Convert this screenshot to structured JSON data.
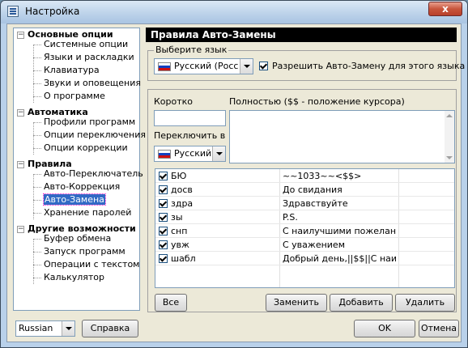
{
  "window": {
    "title": "Настройка",
    "close_label": "x"
  },
  "tree": [
    {
      "label": "Основные опции",
      "cat": true
    },
    {
      "label": "Системные опции"
    },
    {
      "label": "Языки и раскладки"
    },
    {
      "label": "Клавиатура"
    },
    {
      "label": "Звуки и оповещения"
    },
    {
      "label": "О программе"
    },
    {
      "label": "Автоматика",
      "cat": true
    },
    {
      "label": "Профили программ"
    },
    {
      "label": "Опции переключения"
    },
    {
      "label": "Опции коррекции"
    },
    {
      "label": "Правила",
      "cat": true
    },
    {
      "label": "Авто-Переключатель"
    },
    {
      "label": "Авто-Коррекция"
    },
    {
      "label": "Авто-Замена",
      "selected": true
    },
    {
      "label": "Хранение паролей"
    },
    {
      "label": "Другие возможности",
      "cat": true
    },
    {
      "label": "Буфер обмена"
    },
    {
      "label": "Запуск программ"
    },
    {
      "label": "Операции с текстом"
    },
    {
      "label": "Калькулятор"
    }
  ],
  "panel": {
    "header": "Правила Авто-Замены",
    "choose_language_label": "Выберите язык",
    "language_value": "Русский (Россия)",
    "allow_checkbox_label": "Разрешить Авто-Замену для этого языка",
    "allow_checked": true,
    "short_label": "Коротко",
    "short_value": "",
    "full_label": "Полностью ($$ - положение курсора)",
    "full_value": "",
    "switch_label": "Переключить в",
    "switch_value": "Русский"
  },
  "rules": [
    {
      "short": "БЮ",
      "full": "~~1033~~<$$>",
      "checked": true
    },
    {
      "short": "досв",
      "full": "До свидания",
      "checked": true
    },
    {
      "short": "здра",
      "full": "Здравствуйте",
      "checked": true
    },
    {
      "short": "зы",
      "full": "P.S.",
      "checked": true
    },
    {
      "short": "снп",
      "full": "С наилучшими пожелани...",
      "checked": true
    },
    {
      "short": "увж",
      "full": "С уважением",
      "checked": true
    },
    {
      "short": "шабл",
      "full": "Добрый день,||$$||С наил...",
      "checked": true
    }
  ],
  "buttons": {
    "all": "Все",
    "replace": "Заменить",
    "add": "Добавить",
    "delete": "Удалить",
    "help": "Справка",
    "ok": "OK",
    "cancel": "Отмена"
  },
  "ui_language": "Russian",
  "colors": {
    "selection": "#316ac5",
    "header_bg": "#000000",
    "dialog_bg": "#ece9d8"
  }
}
